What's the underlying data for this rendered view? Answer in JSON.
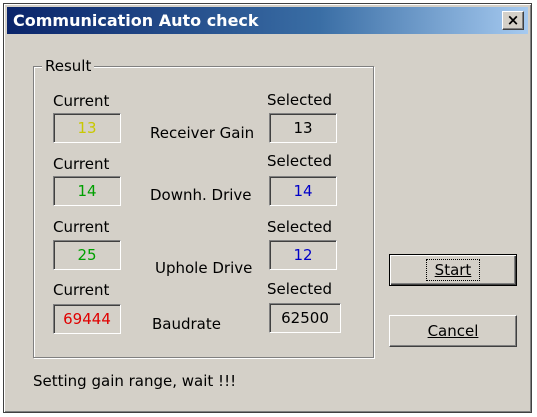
{
  "window": {
    "title": "Communication Auto check",
    "close_label": "×"
  },
  "group": {
    "label": "Result"
  },
  "column_labels": {
    "current": "Current",
    "selected": "Selected"
  },
  "rows": [
    {
      "label": "Receiver Gain",
      "current": "13",
      "current_color": "#c8c800",
      "selected": "13",
      "selected_color": "#000000"
    },
    {
      "label": "Downh. Drive",
      "current": "14",
      "current_color": "#00a000",
      "selected": "14",
      "selected_color": "#0000c8"
    },
    {
      "label": "Uphole Drive",
      "current": "25",
      "current_color": "#00a000",
      "selected": "12",
      "selected_color": "#0000c8"
    },
    {
      "label": "Baudrate",
      "current": "69444",
      "current_color": "#e00000",
      "selected": "62500",
      "selected_color": "#000000"
    }
  ],
  "buttons": {
    "start": "Start",
    "cancel": "Cancel"
  },
  "status": "Setting gain range, wait !!!"
}
